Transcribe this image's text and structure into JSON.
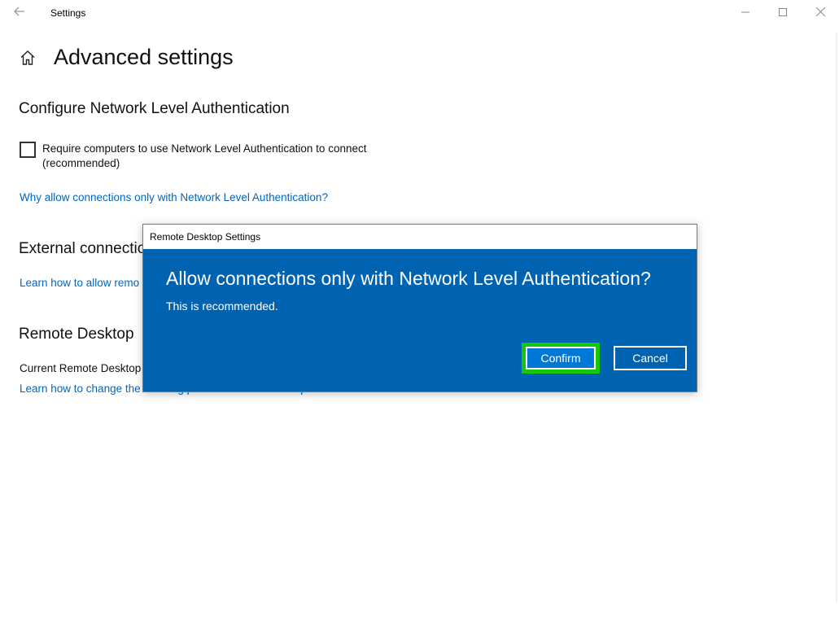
{
  "titlebar": {
    "app_title": "Settings",
    "back_icon": "back-arrow-icon",
    "minimize_icon": "minimize-icon",
    "maximize_icon": "maximize-icon",
    "close_icon": "close-icon"
  },
  "page": {
    "home_icon": "home-icon",
    "title": "Advanced settings"
  },
  "nla_section": {
    "heading": "Configure Network Level Authentication",
    "checkbox_label": "Require computers to use Network Level Authentication to connect (recommended)",
    "checkbox_checked": false,
    "link": "Why allow connections only with Network Level Authentication?"
  },
  "external_section": {
    "heading": "External connectio",
    "link": "Learn how to allow remo"
  },
  "remote_desktop_section": {
    "heading": "Remote Desktop",
    "current_port_text": "Current Remote Desktop",
    "link": "Learn how to change the listening port for Remote Desktop"
  },
  "dialog": {
    "window_title": "Remote Desktop Settings",
    "heading": "Allow connections only with Network Level Authentication?",
    "message": "This is recommended.",
    "confirm_label": "Confirm",
    "cancel_label": "Cancel",
    "background_color": "#0063b1",
    "focus_highlight_color": "#16c60c"
  }
}
